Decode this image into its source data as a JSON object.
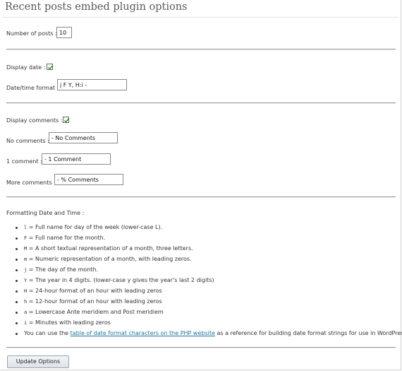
{
  "page": {
    "title": "Recent posts embed plugin options"
  },
  "posts": {
    "number_label": "Number of posts :",
    "number_value": "10"
  },
  "date": {
    "display_label": "Display date :",
    "display_checked": true,
    "format_label": "Date/time format :",
    "format_value": "j F Y, H:i -"
  },
  "comments": {
    "display_label": "Display comments :",
    "display_checked": true,
    "none_label": "No comments :",
    "none_value": "- No Comments",
    "one_label": "1 comment :",
    "one_value": "- 1 Comment",
    "more_label": "More comments :",
    "more_value": "- % Comments"
  },
  "help": {
    "heading": "Formatting Date and Time :",
    "items": [
      {
        "code": "l",
        "text": "= Full name for day of the week (lower-case L)."
      },
      {
        "code": "F",
        "text": "= Full name for the month."
      },
      {
        "code": "M",
        "text": "= A short textual representation of a month, three letters."
      },
      {
        "code": "m",
        "text": "= Numeric representation of a month, with leading zeros."
      },
      {
        "code": "j",
        "text": "= The day of the month."
      },
      {
        "code": "Y",
        "text": "= The year in 4 digits. (lower-case y gives the year's last 2 digits)"
      },
      {
        "code": "H",
        "text": "= 24-hour format of an hour with leading zeros"
      },
      {
        "code": "h",
        "text": "= 12-hour format of an hour with leading zeros"
      },
      {
        "code": "a",
        "text": "= Lowercase Ante meridiem and Post meridiem"
      },
      {
        "code": "i",
        "text": "= Minutes with leading zeros"
      }
    ],
    "last_prefix": "You can use the",
    "last_link": "table of date format characters on the PHP website",
    "last_suffix": "as a reference for building date format strings for use in WordPress."
  },
  "actions": {
    "update_label": "Update Options"
  },
  "colors": {
    "link": "#21759b",
    "checkbox": "#2e7d32"
  }
}
